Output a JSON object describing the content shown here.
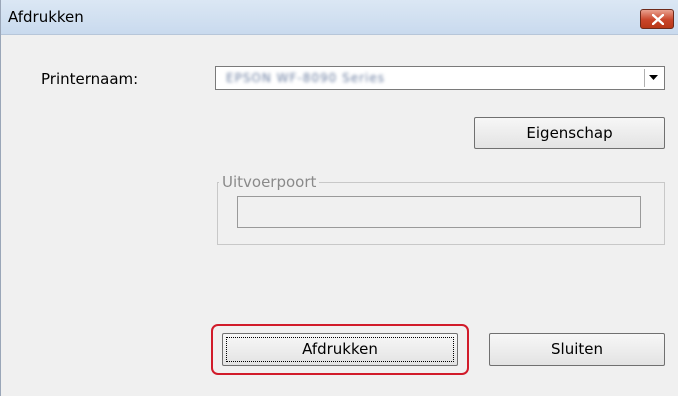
{
  "window": {
    "title": "Afdrukken",
    "close_icon": "close-icon"
  },
  "printer": {
    "label": "Printernaam:",
    "selected_value": "EPSON WF-8090 Series"
  },
  "buttons": {
    "properties_label": "Eigenschap",
    "print_label": "Afdrukken",
    "close_label": "Sluiten"
  },
  "output_port": {
    "legend": "Uitvoerpoort",
    "value": ""
  },
  "colors": {
    "highlight": "#d11b2a",
    "close_button": "#c9452a"
  }
}
